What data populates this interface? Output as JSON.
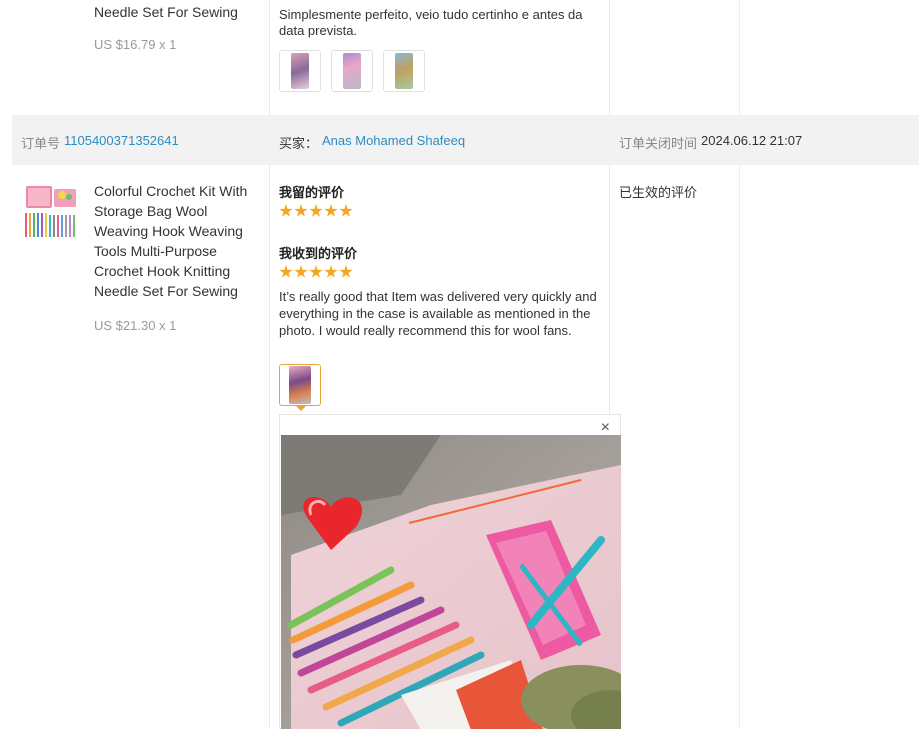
{
  "prev": {
    "title_tail": "Needle Set For Sewing",
    "price": "US $16.79 x 1",
    "review": "Simplesmente perfeito, veio tudo certinho e antes da data prevista."
  },
  "order": {
    "no_label": "订单号",
    "no": "1105400371352641",
    "buyer_label": "买家：",
    "buyer": "Anas Mohamed Shafeeq",
    "close_label": "订单关闭时间",
    "close_time": "2024.06.12 21:07"
  },
  "product": {
    "title": "Colorful Crochet Kit With Storage Bag Wool Weaving Hook Weaving Tools Multi-Purpose Crochet Hook Knitting Needle Set For Sewing",
    "price": "US $21.30 x 1"
  },
  "reviews": {
    "mine_label": "我留的评价",
    "mine_stars": 5,
    "received_label": "我收到的评价",
    "received_stars": 5,
    "received_text": "It’s really good that Item was delivered very quickly and everything in the case is available as mentioned in the photo. I would really recommend this for wool fans."
  },
  "status": {
    "effective": "已生效的评价"
  },
  "preview": {
    "close_glyph": "×"
  },
  "icons": [
    "star-icon",
    "close-icon"
  ],
  "colors": {
    "link": "#2b8ec2",
    "star": "#f5a623",
    "selected": "#e8a33d",
    "bar": "#f2f2f2"
  }
}
